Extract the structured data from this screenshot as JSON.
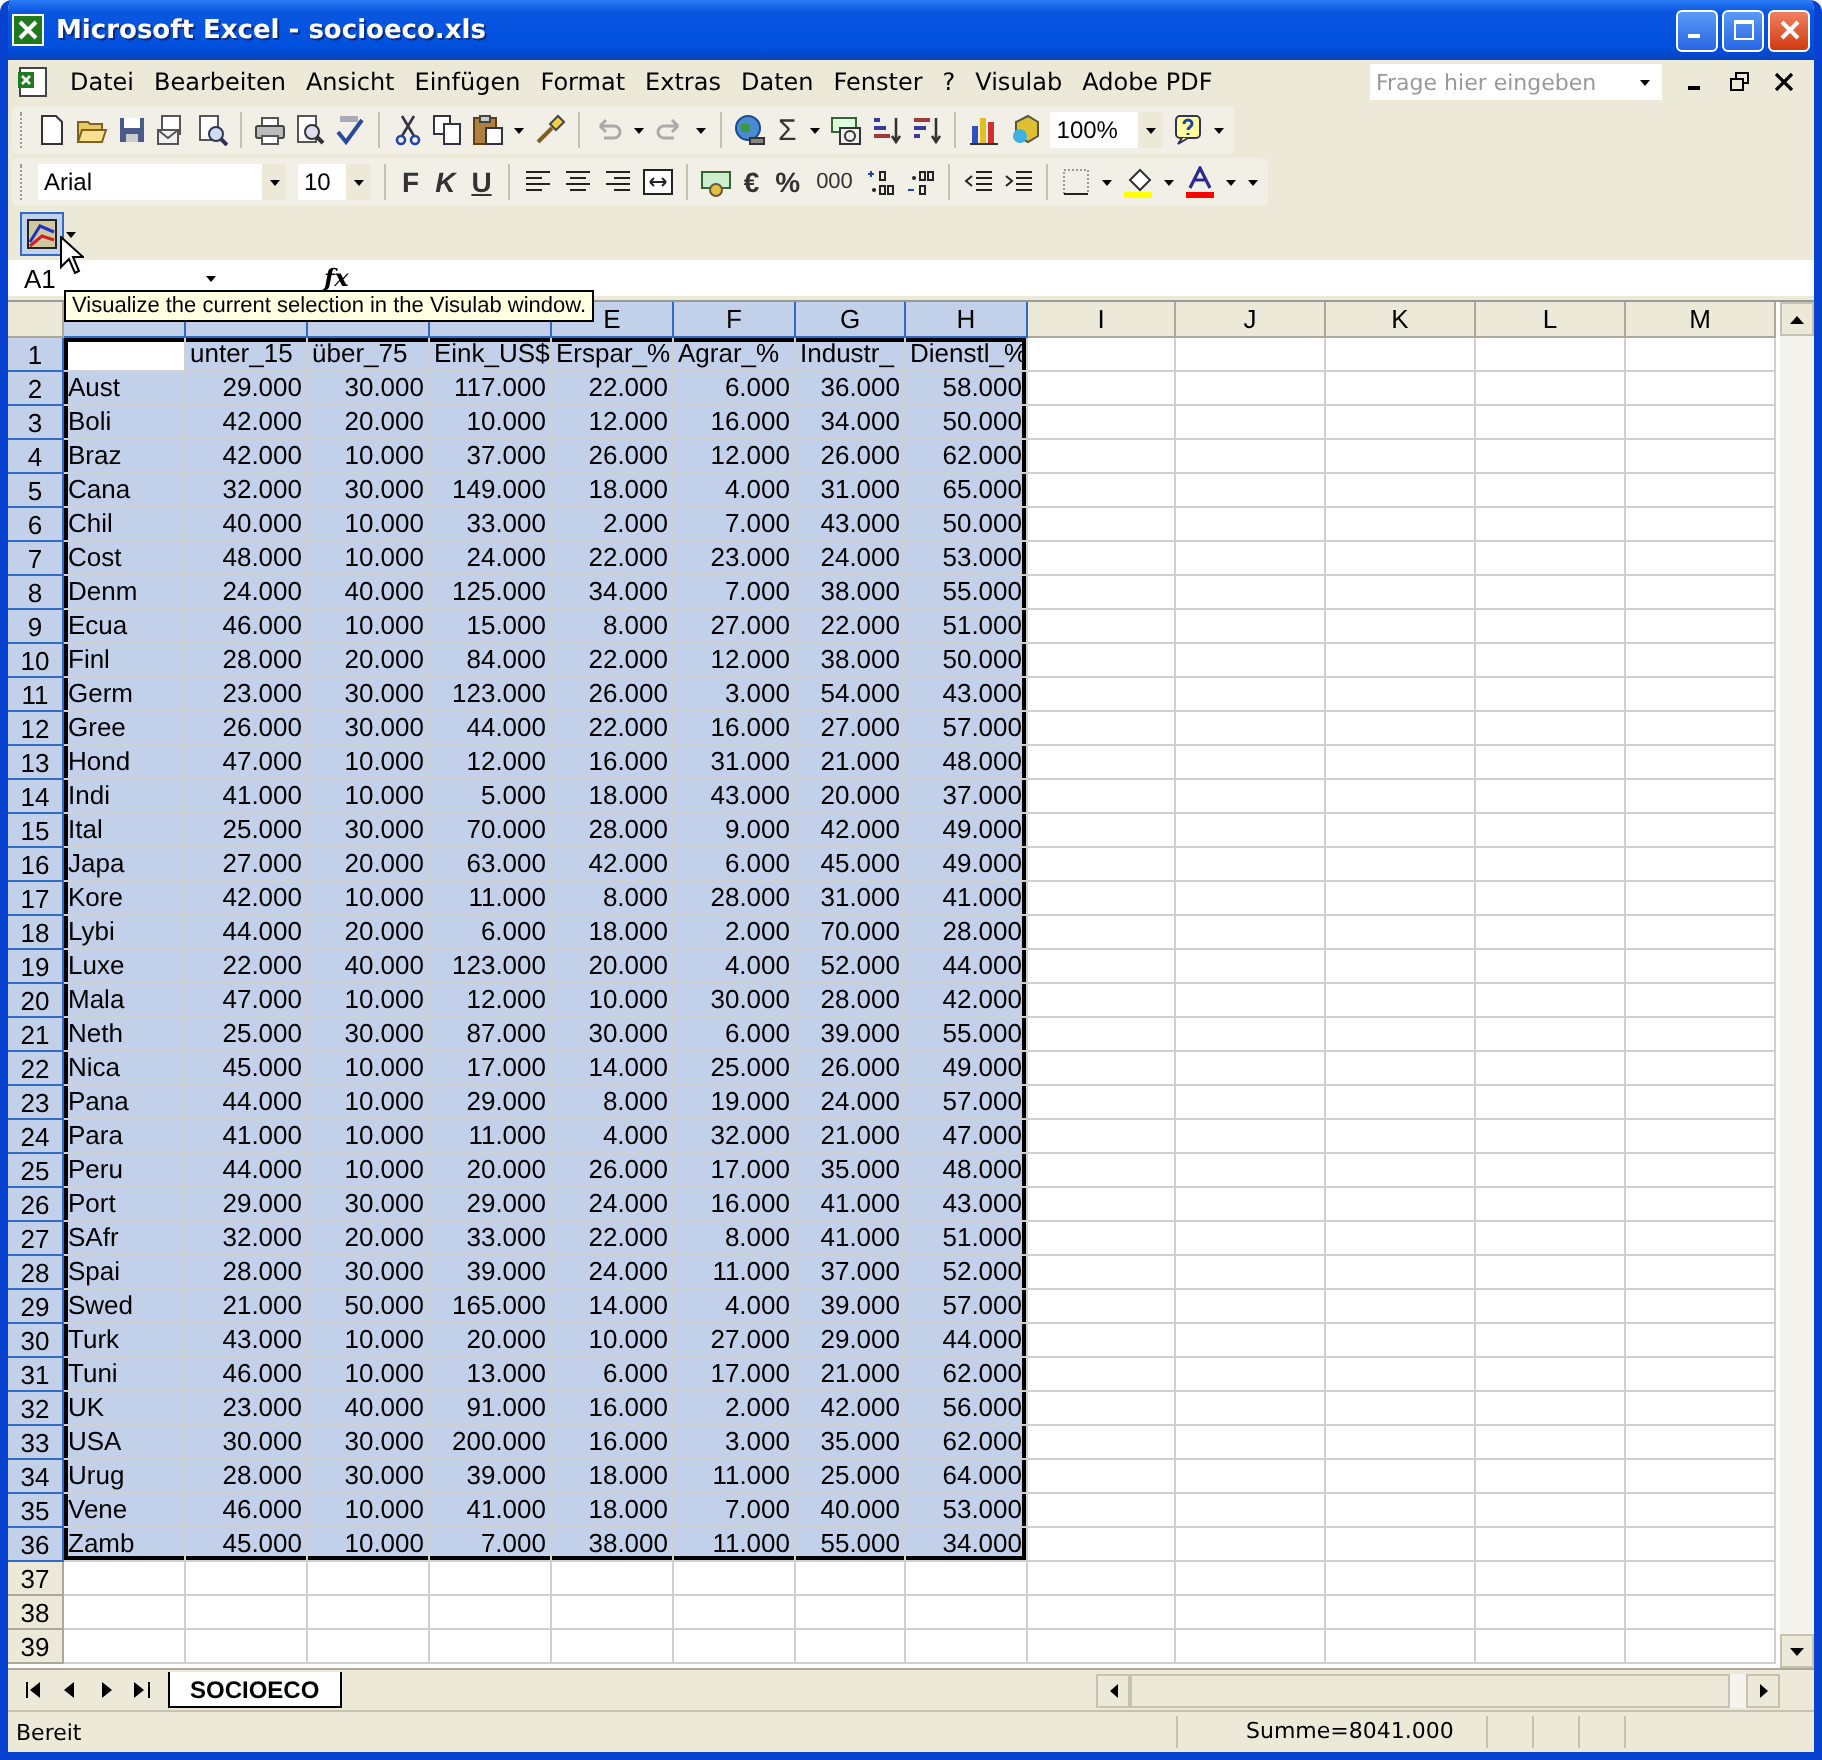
{
  "window": {
    "title": "Microsoft Excel - socioeco.xls"
  },
  "menu": [
    "Datei",
    "Bearbeiten",
    "Ansicht",
    "Einfügen",
    "Format",
    "Extras",
    "Daten",
    "Fenster",
    "?",
    "Visulab",
    "Adobe PDF"
  ],
  "help_field": {
    "placeholder": "Frage hier eingeben"
  },
  "standard_toolbar": {
    "sum": "Σ",
    "zoom": "100%"
  },
  "format_toolbar": {
    "font": "Arial",
    "size": "10",
    "bold": "F",
    "italic": "K",
    "underline": "U",
    "euro": "€",
    "percent": "%",
    "thousands": "000"
  },
  "visulab_toolbar": {
    "pressed": true
  },
  "tooltip": "Visualize the current selection in the Visulab window.",
  "formula_bar": {
    "name_box": "A1",
    "fx": "fx"
  },
  "columns": [
    {
      "selected": true
    },
    {
      "selected": true
    },
    {
      "selected": true
    },
    {
      "selected": true
    },
    {
      "label": "E",
      "selected": true
    },
    {
      "label": "F",
      "selected": true
    },
    {
      "label": "G",
      "selected": true
    },
    {
      "label": "H",
      "selected": true
    },
    {
      "label": "I",
      "selected": false
    },
    {
      "label": "J",
      "selected": false
    },
    {
      "label": "K",
      "selected": false
    },
    {
      "label": "L",
      "selected": false
    },
    {
      "label": "M",
      "selected": false
    }
  ],
  "rows": [
    {
      "number": "1",
      "selected": true,
      "cells": [
        "",
        "unter_15",
        "über_75",
        "Eink_US$",
        "Erspar_%",
        "Agrar_%",
        "Industr_",
        "Dienstl_%"
      ]
    },
    {
      "number": "2",
      "selected": true,
      "cells": [
        "Aust",
        "29.000",
        "30.000",
        "117.000",
        "22.000",
        "6.000",
        "36.000",
        "58.000"
      ]
    },
    {
      "number": "3",
      "selected": true,
      "cells": [
        "Boli",
        "42.000",
        "20.000",
        "10.000",
        "12.000",
        "16.000",
        "34.000",
        "50.000"
      ]
    },
    {
      "number": "4",
      "selected": true,
      "cells": [
        "Braz",
        "42.000",
        "10.000",
        "37.000",
        "26.000",
        "12.000",
        "26.000",
        "62.000"
      ]
    },
    {
      "number": "5",
      "selected": true,
      "cells": [
        "Cana",
        "32.000",
        "30.000",
        "149.000",
        "18.000",
        "4.000",
        "31.000",
        "65.000"
      ]
    },
    {
      "number": "6",
      "selected": true,
      "cells": [
        "Chil",
        "40.000",
        "10.000",
        "33.000",
        "2.000",
        "7.000",
        "43.000",
        "50.000"
      ]
    },
    {
      "number": "7",
      "selected": true,
      "cells": [
        "Cost",
        "48.000",
        "10.000",
        "24.000",
        "22.000",
        "23.000",
        "24.000",
        "53.000"
      ]
    },
    {
      "number": "8",
      "selected": true,
      "cells": [
        "Denm",
        "24.000",
        "40.000",
        "125.000",
        "34.000",
        "7.000",
        "38.000",
        "55.000"
      ]
    },
    {
      "number": "9",
      "selected": true,
      "cells": [
        "Ecua",
        "46.000",
        "10.000",
        "15.000",
        "8.000",
        "27.000",
        "22.000",
        "51.000"
      ]
    },
    {
      "number": "10",
      "selected": true,
      "cells": [
        "Finl",
        "28.000",
        "20.000",
        "84.000",
        "22.000",
        "12.000",
        "38.000",
        "50.000"
      ]
    },
    {
      "number": "11",
      "selected": true,
      "cells": [
        "Germ",
        "23.000",
        "30.000",
        "123.000",
        "26.000",
        "3.000",
        "54.000",
        "43.000"
      ]
    },
    {
      "number": "12",
      "selected": true,
      "cells": [
        "Gree",
        "26.000",
        "30.000",
        "44.000",
        "22.000",
        "16.000",
        "27.000",
        "57.000"
      ]
    },
    {
      "number": "13",
      "selected": true,
      "cells": [
        "Hond",
        "47.000",
        "10.000",
        "12.000",
        "16.000",
        "31.000",
        "21.000",
        "48.000"
      ]
    },
    {
      "number": "14",
      "selected": true,
      "cells": [
        "Indi",
        "41.000",
        "10.000",
        "5.000",
        "18.000",
        "43.000",
        "20.000",
        "37.000"
      ]
    },
    {
      "number": "15",
      "selected": true,
      "cells": [
        "Ital",
        "25.000",
        "30.000",
        "70.000",
        "28.000",
        "9.000",
        "42.000",
        "49.000"
      ]
    },
    {
      "number": "16",
      "selected": true,
      "cells": [
        "Japa",
        "27.000",
        "20.000",
        "63.000",
        "42.000",
        "6.000",
        "45.000",
        "49.000"
      ]
    },
    {
      "number": "17",
      "selected": true,
      "cells": [
        "Kore",
        "42.000",
        "10.000",
        "11.000",
        "8.000",
        "28.000",
        "31.000",
        "41.000"
      ]
    },
    {
      "number": "18",
      "selected": true,
      "cells": [
        "Lybi",
        "44.000",
        "20.000",
        "6.000",
        "18.000",
        "2.000",
        "70.000",
        "28.000"
      ]
    },
    {
      "number": "19",
      "selected": true,
      "cells": [
        "Luxe",
        "22.000",
        "40.000",
        "123.000",
        "20.000",
        "4.000",
        "52.000",
        "44.000"
      ]
    },
    {
      "number": "20",
      "selected": true,
      "cells": [
        "Mala",
        "47.000",
        "10.000",
        "12.000",
        "10.000",
        "30.000",
        "28.000",
        "42.000"
      ]
    },
    {
      "number": "21",
      "selected": true,
      "cells": [
        "Neth",
        "25.000",
        "30.000",
        "87.000",
        "30.000",
        "6.000",
        "39.000",
        "55.000"
      ]
    },
    {
      "number": "22",
      "selected": true,
      "cells": [
        "Nica",
        "45.000",
        "10.000",
        "17.000",
        "14.000",
        "25.000",
        "26.000",
        "49.000"
      ]
    },
    {
      "number": "23",
      "selected": true,
      "cells": [
        "Pana",
        "44.000",
        "10.000",
        "29.000",
        "8.000",
        "19.000",
        "24.000",
        "57.000"
      ]
    },
    {
      "number": "24",
      "selected": true,
      "cells": [
        "Para",
        "41.000",
        "10.000",
        "11.000",
        "4.000",
        "32.000",
        "21.000",
        "47.000"
      ]
    },
    {
      "number": "25",
      "selected": true,
      "cells": [
        "Peru",
        "44.000",
        "10.000",
        "20.000",
        "26.000",
        "17.000",
        "35.000",
        "48.000"
      ]
    },
    {
      "number": "26",
      "selected": true,
      "cells": [
        "Port",
        "29.000",
        "30.000",
        "29.000",
        "24.000",
        "16.000",
        "41.000",
        "43.000"
      ]
    },
    {
      "number": "27",
      "selected": true,
      "cells": [
        "SAfr",
        "32.000",
        "20.000",
        "33.000",
        "22.000",
        "8.000",
        "41.000",
        "51.000"
      ]
    },
    {
      "number": "28",
      "selected": true,
      "cells": [
        "Spai",
        "28.000",
        "30.000",
        "39.000",
        "24.000",
        "11.000",
        "37.000",
        "52.000"
      ]
    },
    {
      "number": "29",
      "selected": true,
      "cells": [
        "Swed",
        "21.000",
        "50.000",
        "165.000",
        "14.000",
        "4.000",
        "39.000",
        "57.000"
      ]
    },
    {
      "number": "30",
      "selected": true,
      "cells": [
        "Turk",
        "43.000",
        "10.000",
        "20.000",
        "10.000",
        "27.000",
        "29.000",
        "44.000"
      ]
    },
    {
      "number": "31",
      "selected": true,
      "cells": [
        "Tuni",
        "46.000",
        "10.000",
        "13.000",
        "6.000",
        "17.000",
        "21.000",
        "62.000"
      ]
    },
    {
      "number": "32",
      "selected": true,
      "cells": [
        "UK",
        "23.000",
        "40.000",
        "91.000",
        "16.000",
        "2.000",
        "42.000",
        "56.000"
      ]
    },
    {
      "number": "33",
      "selected": true,
      "cells": [
        "USA",
        "30.000",
        "30.000",
        "200.000",
        "16.000",
        "3.000",
        "35.000",
        "62.000"
      ]
    },
    {
      "number": "34",
      "selected": true,
      "cells": [
        "Urug",
        "28.000",
        "30.000",
        "39.000",
        "18.000",
        "11.000",
        "25.000",
        "64.000"
      ]
    },
    {
      "number": "35",
      "selected": true,
      "cells": [
        "Vene",
        "46.000",
        "10.000",
        "41.000",
        "18.000",
        "7.000",
        "40.000",
        "53.000"
      ]
    },
    {
      "number": "36",
      "selected": true,
      "cells": [
        "Zamb",
        "45.000",
        "10.000",
        "7.000",
        "38.000",
        "11.000",
        "55.000",
        "34.000"
      ]
    },
    {
      "number": "37",
      "selected": false
    },
    {
      "number": "38",
      "selected": false
    },
    {
      "number": "39",
      "selected": false
    }
  ],
  "sheet_tabs": [
    {
      "label": "SOCIOECO",
      "selected": true
    }
  ],
  "status_bar": {
    "status": "Bereit",
    "sum": "Summe=8041.000"
  }
}
